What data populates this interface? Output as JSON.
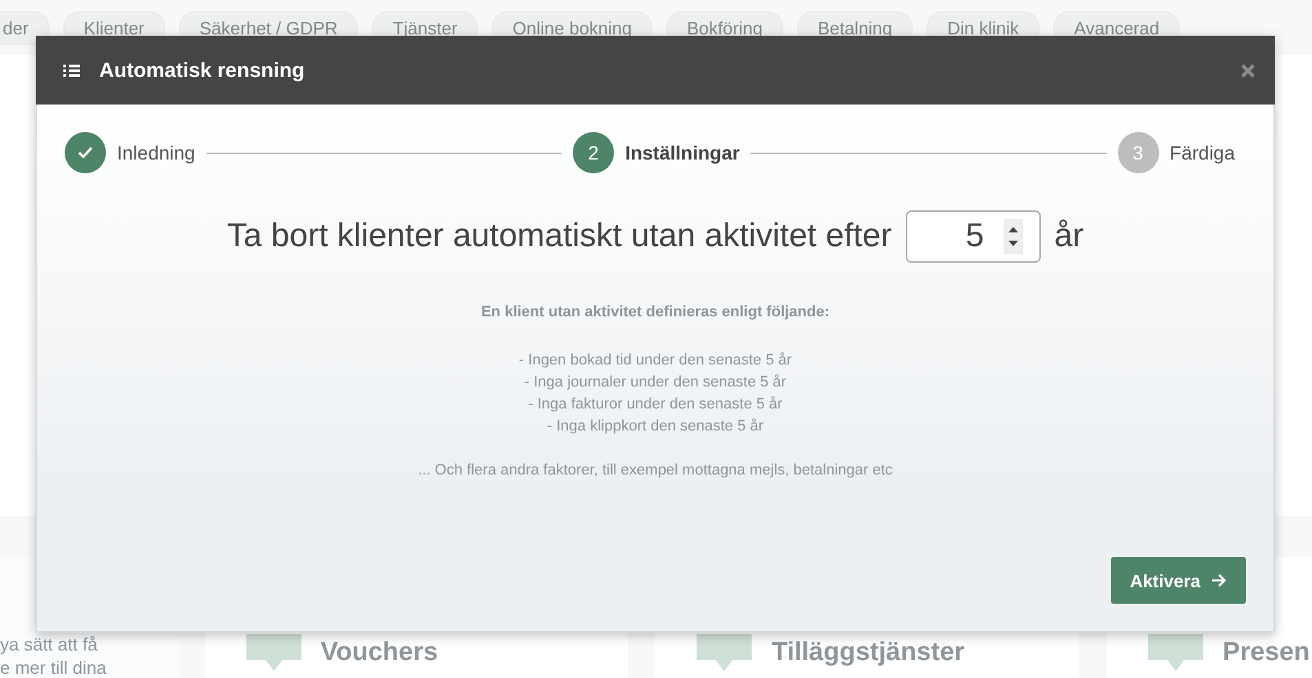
{
  "background": {
    "tabs": [
      {
        "label": "der"
      },
      {
        "label": "Klienter"
      },
      {
        "label": "Säkerhet / GDPR"
      },
      {
        "label": "Tjänster"
      },
      {
        "label": "Online bokning"
      },
      {
        "label": "Bokföring"
      },
      {
        "label": "Betalning"
      },
      {
        "label": "Din klinik"
      },
      {
        "label": "Avancerad"
      }
    ],
    "side_text": [
      "ya sätt att få",
      "e mer till dina"
    ],
    "cards": [
      {
        "title": "Vouchers"
      },
      {
        "title": "Tilläggstjänster"
      },
      {
        "title": "Presen"
      }
    ]
  },
  "modal": {
    "title": "Automatisk rensning",
    "steps": [
      {
        "label": "Inledning",
        "done": true,
        "selected": false
      },
      {
        "number": "2",
        "label": "Inställningar",
        "done": false,
        "selected": true
      },
      {
        "number": "3",
        "label": "Färdiga",
        "done": false,
        "selected": false
      }
    ],
    "question": "Ta bort klienter automatiskt utan aktivitet efter",
    "input_value": "5",
    "unit": "år",
    "definition_heading": "En klient utan aktivitet definieras enligt följande:",
    "criteria": [
      "- Ingen bokad tid under den senaste 5 år",
      "- Inga journaler under den senaste 5 år",
      "- Inga fakturor under den senaste 5 år",
      "- Inga klippkort den senaste 5 år"
    ],
    "note": "... Och flera andra faktorer, till exempel mottagna mejls, betalningar etc",
    "button": "Aktivera"
  }
}
